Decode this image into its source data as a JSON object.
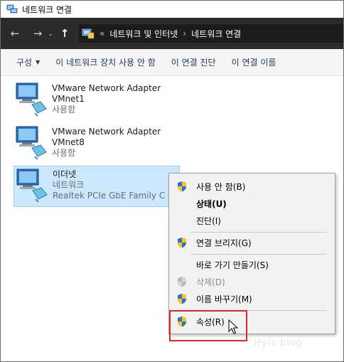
{
  "window": {
    "title": "네트워크 연결"
  },
  "nav": {
    "back_icon": "back-arrow-icon",
    "forward_icon": "forward-arrow-icon",
    "up_icon": "up-arrow-icon",
    "breadcrumb_overflow": "«",
    "breadcrumbs": [
      "네트워크 및 인터넷",
      "네트워크 연결"
    ],
    "separator": "›"
  },
  "toolbar": {
    "organize": "구성",
    "disable": "이 네트워크 장치 사용 안 함",
    "diagnose": "이 연결 진단",
    "rename": "이 연결 이름"
  },
  "adapters": [
    {
      "name": "VMware Network Adapter",
      "sub1": "VMnet1",
      "sub2": "사용함"
    },
    {
      "name": "VMware Network Adapter",
      "sub1": "VMnet8",
      "sub2": "사용함"
    },
    {
      "name": "이더넷",
      "sub1": "네트워크",
      "sub2": "Realtek PCIe GbE Family C"
    }
  ],
  "context_menu": {
    "items": [
      {
        "label": "사용 안 함(B)",
        "shield": true,
        "bold": false,
        "disabled": false
      },
      {
        "label": "상태(U)",
        "shield": false,
        "bold": true,
        "disabled": false
      },
      {
        "label": "진단(I)",
        "shield": false,
        "bold": false,
        "disabled": false
      },
      {
        "label": "연결 브리지(G)",
        "shield": true,
        "bold": false,
        "disabled": false
      },
      {
        "label": "바로 가기 만들기(S)",
        "shield": false,
        "bold": false,
        "disabled": false
      },
      {
        "label": "삭제(D)",
        "shield": true,
        "bold": false,
        "disabled": true
      },
      {
        "label": "이름 바꾸기(M)",
        "shield": true,
        "bold": false,
        "disabled": false
      },
      {
        "label": "속성(R)",
        "shield": true,
        "bold": false,
        "disabled": false
      }
    ]
  },
  "watermark": "Hyis blog",
  "colors": {
    "selection": "#cce8ff",
    "highlight_box": "#e0262b",
    "nav_bg": "#2b2b2b"
  }
}
